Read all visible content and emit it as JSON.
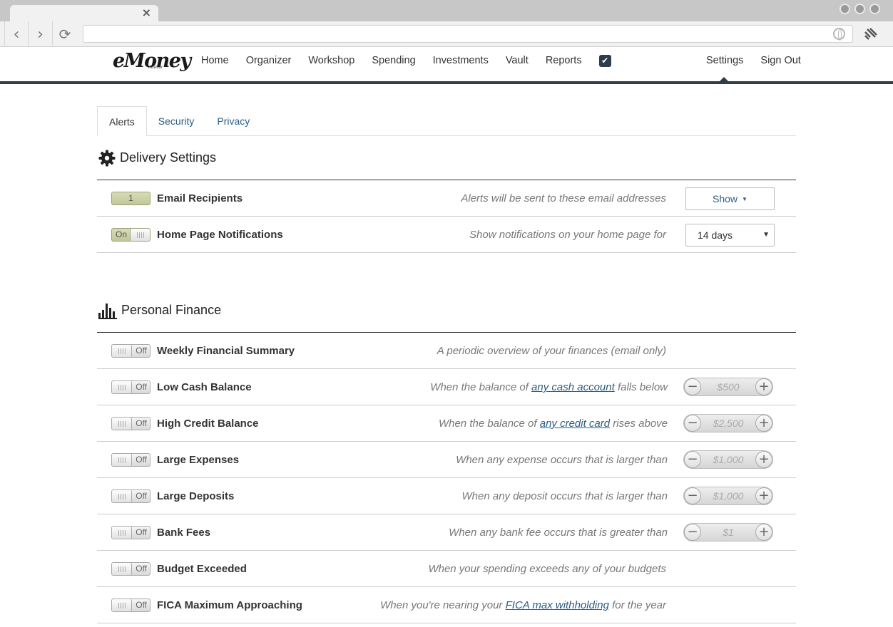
{
  "browser": {
    "tab_close": "×",
    "back": "‹",
    "forward": "›",
    "reload": "⟳"
  },
  "header": {
    "logo": "eMoney",
    "logo_sub": "Advisor",
    "nav": [
      "Home",
      "Organizer",
      "Workshop",
      "Spending",
      "Investments",
      "Vault",
      "Reports"
    ],
    "check_icon": "✔",
    "settings": "Settings",
    "sign_out": "Sign Out",
    "accent_color": "#2e3d4d"
  },
  "tabs": [
    "Alerts",
    "Security",
    "Privacy"
  ],
  "delivery": {
    "title": "Delivery Settings",
    "email": {
      "count": "1",
      "title": "Email Recipients",
      "desc": "Alerts will be sent to these email addresses",
      "button": "Show",
      "caret": "▼"
    },
    "home": {
      "toggle": "On",
      "title": "Home Page Notifications",
      "desc": "Show notifications on your home page for",
      "select": "14 days",
      "arrow": "▼"
    }
  },
  "finance": {
    "title": "Personal Finance",
    "toggle_label": "Off",
    "minus": "−",
    "plus": "+",
    "rows": [
      {
        "title": "Weekly Financial Summary",
        "desc_a": "A periodic overview of your finances (email only)"
      },
      {
        "title": "Low Cash Balance",
        "desc_a": "When the balance of ",
        "link": "any cash account",
        "desc_b": " falls below",
        "value": "$500"
      },
      {
        "title": "High Credit Balance",
        "desc_a": "When the balance of ",
        "link": "any credit card",
        "desc_b": " rises above",
        "value": "$2,500"
      },
      {
        "title": "Large Expenses",
        "desc_a": "When any expense occurs that is larger than",
        "value": "$1,000"
      },
      {
        "title": "Large Deposits",
        "desc_a": "When any deposit occurs that is larger than",
        "value": "$1,000"
      },
      {
        "title": "Bank Fees",
        "desc_a": "When any bank fee occurs that is greater than",
        "value": "$1"
      },
      {
        "title": "Budget Exceeded",
        "desc_a": "When your spending exceeds any of your budgets"
      },
      {
        "title": "FICA Maximum Approaching",
        "desc_a": "When you're nearing your ",
        "link": "FICA max withholding",
        "desc_b": " for the year"
      }
    ]
  }
}
